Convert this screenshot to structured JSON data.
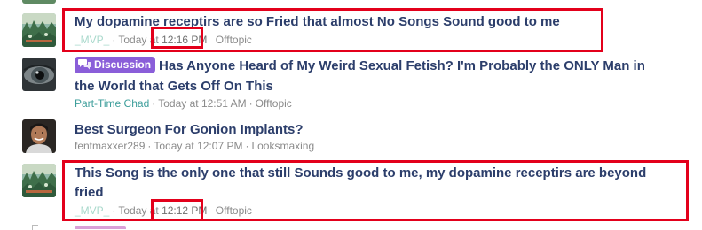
{
  "threads": [
    {
      "title": "My dopamine receptirs are so Fried that almost No Songs Sound good to me",
      "author": "_MVP_",
      "date_prefix": "Today at ",
      "time": "12:16 PM",
      "forum": "Offtopic",
      "avatar": "forest-scene-avatar"
    },
    {
      "badge": "Discussion",
      "title_line1": "Has Anyone Heard of My Weird Sexual Fetish? I'm Probably the ONLY Man in",
      "title_line2": "the World that Gets Off On This",
      "author": "Part-Time Chad",
      "date": "Today at 12:51 AM",
      "forum": "Offtopic",
      "avatar": "eye-avatar"
    },
    {
      "title": "Best Surgeon For Gonion Implants?",
      "author": "fentmaxxer289",
      "date": "Today at 12:07 PM",
      "forum": "Looksmaxing",
      "avatar": "man-portrait-avatar"
    },
    {
      "title_line1": "This Song is the only one that still Sounds good to me, my dopamine receptirs are beyond",
      "title_line2": "fried",
      "author": "_MVP_",
      "date_prefix": "Today at ",
      "time": "12:12 PM",
      "forum": "Offtopic",
      "avatar": "forest-scene-avatar"
    }
  ],
  "meta_separator": "·",
  "colors": {
    "title": "#2c3e6b",
    "badge": "#8a5ed9",
    "highlight": "#e3001b",
    "username_teal": "#3d9e9b",
    "username_mvp": "#a9d9cc"
  }
}
